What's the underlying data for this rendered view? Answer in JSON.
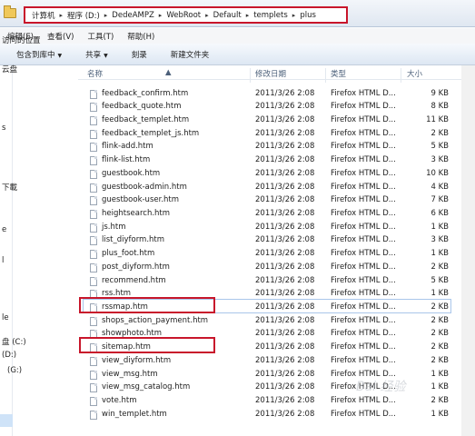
{
  "breadcrumb": [
    "计算机",
    "程序 (D:)",
    "DedeAMPZ",
    "WebRoot",
    "Default",
    "templets",
    "plus"
  ],
  "menu": [
    "编辑(E)",
    "查看(V)",
    "工具(T)",
    "帮助(H)"
  ],
  "toolbar": {
    "include": "包含到库中",
    "share": "共享",
    "burn": "刻录",
    "new_folder": "新建文件夹"
  },
  "nav": [
    "访问的位置",
    "云盘",
    "s",
    "下載",
    "e",
    "l",
    "le",
    "盘 (C:)",
    "(D:)",
    "(G:)"
  ],
  "columns": {
    "name": "名称",
    "date": "修改日期",
    "type": "类型",
    "size": "大小"
  },
  "files": [
    {
      "name": "feedback_confirm.htm",
      "date": "2011/3/26 2:08",
      "type": "Firefox HTML D...",
      "size": "9 KB"
    },
    {
      "name": "feedback_quote.htm",
      "date": "2011/3/26 2:08",
      "type": "Firefox HTML D...",
      "size": "8 KB"
    },
    {
      "name": "feedback_templet.htm",
      "date": "2011/3/26 2:08",
      "type": "Firefox HTML D...",
      "size": "11 KB"
    },
    {
      "name": "feedback_templet_js.htm",
      "date": "2011/3/26 2:08",
      "type": "Firefox HTML D...",
      "size": "2 KB"
    },
    {
      "name": "flink-add.htm",
      "date": "2011/3/26 2:08",
      "type": "Firefox HTML D...",
      "size": "5 KB"
    },
    {
      "name": "flink-list.htm",
      "date": "2011/3/26 2:08",
      "type": "Firefox HTML D...",
      "size": "3 KB"
    },
    {
      "name": "guestbook.htm",
      "date": "2011/3/26 2:08",
      "type": "Firefox HTML D...",
      "size": "10 KB"
    },
    {
      "name": "guestbook-admin.htm",
      "date": "2011/3/26 2:08",
      "type": "Firefox HTML D...",
      "size": "4 KB"
    },
    {
      "name": "guestbook-user.htm",
      "date": "2011/3/26 2:08",
      "type": "Firefox HTML D...",
      "size": "7 KB"
    },
    {
      "name": "heightsearch.htm",
      "date": "2011/3/26 2:08",
      "type": "Firefox HTML D...",
      "size": "6 KB"
    },
    {
      "name": "js.htm",
      "date": "2011/3/26 2:08",
      "type": "Firefox HTML D...",
      "size": "1 KB"
    },
    {
      "name": "list_diyform.htm",
      "date": "2011/3/26 2:08",
      "type": "Firefox HTML D...",
      "size": "3 KB"
    },
    {
      "name": "plus_foot.htm",
      "date": "2011/3/26 2:08",
      "type": "Firefox HTML D...",
      "size": "1 KB"
    },
    {
      "name": "post_diyform.htm",
      "date": "2011/3/26 2:08",
      "type": "Firefox HTML D...",
      "size": "2 KB"
    },
    {
      "name": "recommend.htm",
      "date": "2011/3/26 2:08",
      "type": "Firefox HTML D...",
      "size": "5 KB"
    },
    {
      "name": "rss.htm",
      "date": "2011/3/26 2:08",
      "type": "Firefox HTML D...",
      "size": "1 KB"
    },
    {
      "name": "rssmap.htm",
      "date": "2011/3/26 2:08",
      "type": "Firefox HTML D...",
      "size": "2 KB"
    },
    {
      "name": "shops_action_payment.htm",
      "date": "2011/3/26 2:08",
      "type": "Firefox HTML D...",
      "size": "2 KB"
    },
    {
      "name": "showphoto.htm",
      "date": "2011/3/26 2:08",
      "type": "Firefox HTML D...",
      "size": "2 KB"
    },
    {
      "name": "sitemap.htm",
      "date": "2011/3/26 2:08",
      "type": "Firefox HTML D...",
      "size": "2 KB"
    },
    {
      "name": "view_diyform.htm",
      "date": "2011/3/26 2:08",
      "type": "Firefox HTML D...",
      "size": "2 KB"
    },
    {
      "name": "view_msg.htm",
      "date": "2011/3/26 2:08",
      "type": "Firefox HTML D...",
      "size": "1 KB"
    },
    {
      "name": "view_msg_catalog.htm",
      "date": "2011/3/26 2:08",
      "type": "Firefox HTML D...",
      "size": "1 KB"
    },
    {
      "name": "vote.htm",
      "date": "2011/3/26 2:08",
      "type": "Firefox HTML D...",
      "size": "2 KB"
    },
    {
      "name": "win_templet.htm",
      "date": "2011/3/26 2:08",
      "type": "Firefox HTML D...",
      "size": "1 KB"
    }
  ],
  "highlighted": [
    "rssmap.htm",
    "sitemap.htm"
  ],
  "highlight_color": "#c8162b",
  "icons": {
    "folder": "folder-icon",
    "file": "html-file-icon"
  }
}
